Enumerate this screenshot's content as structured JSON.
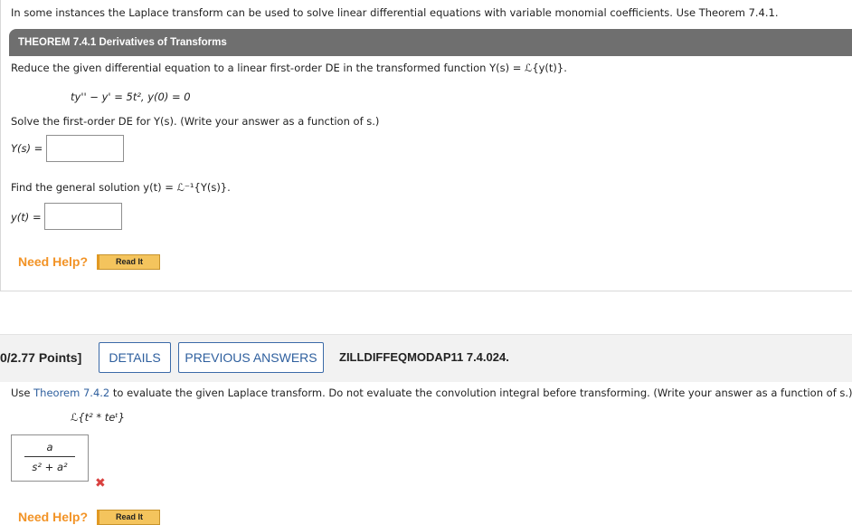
{
  "question1": {
    "intro": "In some instances the Laplace transform can be used to solve linear differential equations with variable monomial coefficients. Use Theorem 7.4.1.",
    "theorem_title": "THEOREM 7.4.1 Derivatives of Transforms",
    "instruction": "Reduce the given differential equation to a linear first-order DE in the transformed function Y(s) = ℒ{y(t)}.",
    "equation": "ty'' − y' = 5t², y(0) = 0",
    "solve_prompt": "Solve the first-order DE for Y(s). (Write your answer as a function of s.)",
    "ys_label": "Y(s) =",
    "ys_value": "",
    "general_prompt": "Find the general solution y(t) = ℒ⁻¹{Y(s)}.",
    "yt_label": "y(t) =",
    "yt_value": "",
    "need_help": "Need Help?",
    "read_it": "Read It"
  },
  "question2": {
    "points": "0/2.77 Points]",
    "details_label": "DETAILS",
    "previous_answers_label": "PREVIOUS ANSWERS",
    "problem_id": "ZILLDIFFEQMODAP11 7.4.024.",
    "instruction_prefix": "Use ",
    "theorem_link": "Theorem 7.4.2",
    "instruction_suffix": " to evaluate the given Laplace transform. Do not evaluate the convolution integral before transforming. (Write your answer as a function of s.)",
    "expression": "ℒ{t² * teᵗ}",
    "answer_numerator": "a",
    "answer_denominator": "s² + a²",
    "result_mark": "incorrect-x",
    "need_help": "Need Help?",
    "read_it": "Read It"
  },
  "colors": {
    "theorem_bar": "#6f6f6f",
    "need_help": "#f29326",
    "read_button": "#f4c45d",
    "link_blue": "#2e5f9e",
    "wrong_red": "#d9413f"
  }
}
